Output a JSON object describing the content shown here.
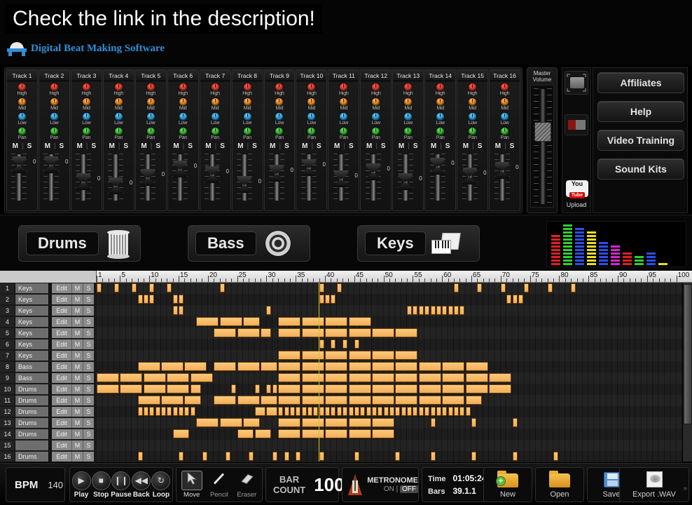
{
  "banner": {
    "headline": "Check the link in the description!",
    "logo_text": "Digital Beat Making Software",
    "logo_color": "#2e8fd6"
  },
  "mixer": {
    "knob_labels": [
      "High",
      "Mid",
      "Low",
      "Pan"
    ],
    "knob_colors": {
      "high": "#d8301c",
      "mid": "#e08a12",
      "low": "#1f9bd8",
      "pan": "#28a828"
    },
    "mute_label": "M",
    "solo_label": "S",
    "fader_value": "0",
    "tracks": [
      {
        "name": "Track 1"
      },
      {
        "name": "Track 2"
      },
      {
        "name": "Track 3"
      },
      {
        "name": "Track 4"
      },
      {
        "name": "Track 5"
      },
      {
        "name": "Track 6"
      },
      {
        "name": "Track 7"
      },
      {
        "name": "Track 8"
      },
      {
        "name": "Track 9"
      },
      {
        "name": "Track 10"
      },
      {
        "name": "Track 11"
      },
      {
        "name": "Track 12"
      },
      {
        "name": "Track 13"
      },
      {
        "name": "Track 14"
      },
      {
        "name": "Track 15"
      },
      {
        "name": "Track 16"
      }
    ],
    "fader_positions": [
      6,
      6,
      30,
      36,
      24,
      12,
      20,
      34,
      18,
      10,
      26,
      16,
      30,
      8,
      22,
      14
    ]
  },
  "master": {
    "label_line1": "Master",
    "label_line2": "Volume"
  },
  "side_panel": {
    "youtube_you": "You",
    "youtube_tube": "Tube",
    "upload_label": "Upload"
  },
  "right_buttons": [
    {
      "label": "Affiliates"
    },
    {
      "label": "Help"
    },
    {
      "label": "Video Training"
    },
    {
      "label": "Sound Kits"
    }
  ],
  "instruments": [
    {
      "label": "Drums",
      "icon": "drum-icon"
    },
    {
      "label": "Bass",
      "icon": "speaker-icon"
    },
    {
      "label": "Keys",
      "icon": "piano-folder-icon"
    }
  ],
  "spectrum": {
    "bars": [
      {
        "color": "#e02020",
        "level": 9
      },
      {
        "color": "#2fd02f",
        "level": 12
      },
      {
        "color": "#2a50e8",
        "level": 11
      },
      {
        "color": "#e8e020",
        "level": 10
      },
      {
        "color": "#2a50e8",
        "level": 7
      },
      {
        "color": "#d028c8",
        "level": 6
      },
      {
        "color": "#e02020",
        "level": 4
      },
      {
        "color": "#2fd02f",
        "level": 3
      },
      {
        "color": "#2a50e8",
        "level": 4
      },
      {
        "color": "#e8e020",
        "level": 1
      }
    ]
  },
  "sequencer": {
    "ruler_start": 1,
    "ruler_end": 100,
    "ruler_labels": [
      1,
      5,
      10,
      15,
      20,
      25,
      30,
      35,
      40,
      45,
      50,
      55,
      60,
      65,
      70,
      75,
      80,
      85,
      90,
      95,
      100
    ],
    "playhead_bar": 39,
    "edit_label": "Edit",
    "mute_label": "M",
    "solo_label": "S",
    "tracks": [
      {
        "num": "1",
        "name": "Keys"
      },
      {
        "num": "2",
        "name": "Keys"
      },
      {
        "num": "3",
        "name": "Keys"
      },
      {
        "num": "4",
        "name": "Keys"
      },
      {
        "num": "5",
        "name": "Keys"
      },
      {
        "num": "6",
        "name": "Keys"
      },
      {
        "num": "7",
        "name": "Keys"
      },
      {
        "num": "8",
        "name": "Bass"
      },
      {
        "num": "9",
        "name": "Bass"
      },
      {
        "num": "10",
        "name": "Drums"
      },
      {
        "num": "11",
        "name": "Drums"
      },
      {
        "num": "12",
        "name": "Drums"
      },
      {
        "num": "13",
        "name": "Drums"
      },
      {
        "num": "14",
        "name": "Drums"
      },
      {
        "num": "15",
        "name": ""
      },
      {
        "num": "16",
        "name": "Drums"
      }
    ],
    "notes": [
      [
        [
          1,
          1
        ],
        [
          4,
          1
        ],
        [
          7,
          1
        ],
        [
          10,
          1
        ],
        [
          13,
          1
        ],
        [
          22,
          1
        ],
        [
          39,
          1
        ],
        [
          42,
          1
        ],
        [
          62,
          1
        ],
        [
          66,
          1
        ],
        [
          70,
          1
        ],
        [
          74,
          1
        ],
        [
          78,
          1
        ],
        [
          82,
          1
        ]
      ],
      [
        [
          8,
          1
        ],
        [
          9,
          1
        ],
        [
          10,
          1
        ],
        [
          14,
          1
        ],
        [
          15,
          1
        ],
        [
          39,
          1
        ],
        [
          40,
          1
        ],
        [
          41,
          1
        ],
        [
          71,
          1
        ],
        [
          72,
          1
        ],
        [
          73,
          1
        ]
      ],
      [
        [
          14,
          1
        ],
        [
          15,
          1
        ],
        [
          30,
          1
        ],
        [
          54,
          1
        ],
        [
          55,
          1
        ],
        [
          56,
          1
        ],
        [
          57,
          1
        ],
        [
          58,
          1
        ],
        [
          59,
          1
        ],
        [
          60,
          1
        ],
        [
          61,
          1
        ],
        [
          62,
          1
        ],
        [
          63,
          1
        ]
      ],
      [
        [
          18,
          4
        ],
        [
          22,
          4
        ],
        [
          26,
          3
        ],
        [
          32,
          4
        ],
        [
          36,
          4
        ],
        [
          40,
          4
        ],
        [
          44,
          4
        ]
      ],
      [
        [
          21,
          4
        ],
        [
          25,
          4
        ],
        [
          29,
          2
        ],
        [
          32,
          4
        ],
        [
          36,
          4
        ],
        [
          40,
          4
        ],
        [
          44,
          4
        ],
        [
          48,
          4
        ],
        [
          52,
          4
        ]
      ],
      [
        [
          39,
          1
        ],
        [
          41,
          1
        ],
        [
          43,
          1
        ],
        [
          45,
          1
        ]
      ],
      [
        [
          32,
          4
        ],
        [
          36,
          4
        ],
        [
          40,
          4
        ],
        [
          44,
          4
        ],
        [
          48,
          4
        ],
        [
          52,
          4
        ]
      ],
      [
        [
          8,
          4
        ],
        [
          12,
          4
        ],
        [
          16,
          4
        ],
        [
          21,
          4
        ],
        [
          25,
          4
        ],
        [
          29,
          3
        ],
        [
          32,
          4
        ],
        [
          36,
          4
        ],
        [
          40,
          4
        ],
        [
          44,
          4
        ],
        [
          48,
          4
        ],
        [
          52,
          4
        ],
        [
          56,
          4
        ],
        [
          60,
          4
        ],
        [
          64,
          4
        ]
      ],
      [
        [
          1,
          4
        ],
        [
          5,
          4
        ],
        [
          9,
          4
        ],
        [
          13,
          4
        ],
        [
          17,
          4
        ],
        [
          32,
          4
        ],
        [
          36,
          4
        ],
        [
          40,
          4
        ],
        [
          44,
          4
        ],
        [
          48,
          4
        ],
        [
          52,
          4
        ],
        [
          56,
          4
        ],
        [
          60,
          4
        ],
        [
          64,
          4
        ],
        [
          68,
          4
        ]
      ],
      [
        [
          1,
          4
        ],
        [
          5,
          4
        ],
        [
          9,
          4
        ],
        [
          13,
          4
        ],
        [
          17,
          2
        ],
        [
          24,
          1
        ],
        [
          28,
          1
        ],
        [
          30,
          1
        ],
        [
          31,
          1
        ],
        [
          32,
          4
        ],
        [
          36,
          4
        ],
        [
          40,
          4
        ],
        [
          44,
          4
        ],
        [
          48,
          4
        ],
        [
          52,
          4
        ],
        [
          56,
          4
        ],
        [
          60,
          4
        ],
        [
          64,
          4
        ],
        [
          68,
          4
        ]
      ],
      [
        [
          8,
          4
        ],
        [
          12,
          4
        ],
        [
          16,
          3
        ],
        [
          21,
          4
        ],
        [
          25,
          4
        ],
        [
          29,
          3
        ],
        [
          32,
          4
        ],
        [
          36,
          4
        ],
        [
          40,
          4
        ],
        [
          44,
          4
        ],
        [
          48,
          4
        ],
        [
          52,
          4
        ],
        [
          56,
          4
        ],
        [
          60,
          4
        ],
        [
          64,
          3
        ]
      ],
      [
        [
          8,
          1
        ],
        [
          9,
          1
        ],
        [
          10,
          1
        ],
        [
          11,
          1
        ],
        [
          12,
          1
        ],
        [
          13,
          1
        ],
        [
          14,
          1
        ],
        [
          15,
          1
        ],
        [
          16,
          1
        ],
        [
          17,
          1
        ],
        [
          28,
          2
        ],
        [
          30,
          2
        ],
        [
          32,
          1
        ],
        [
          33,
          1
        ],
        [
          34,
          1
        ],
        [
          35,
          1
        ],
        [
          36,
          1
        ],
        [
          37,
          1
        ],
        [
          38,
          1
        ],
        [
          39,
          1
        ],
        [
          40,
          1
        ],
        [
          41,
          1
        ],
        [
          42,
          1
        ],
        [
          43,
          1
        ],
        [
          44,
          1
        ],
        [
          45,
          1
        ],
        [
          46,
          1
        ],
        [
          47,
          1
        ],
        [
          48,
          1
        ],
        [
          49,
          1
        ],
        [
          50,
          1
        ],
        [
          51,
          1
        ],
        [
          52,
          1
        ],
        [
          53,
          1
        ],
        [
          54,
          1
        ],
        [
          55,
          1
        ],
        [
          56,
          1
        ],
        [
          57,
          1
        ],
        [
          58,
          1
        ],
        [
          59,
          1
        ],
        [
          60,
          1
        ],
        [
          61,
          1
        ],
        [
          62,
          1
        ],
        [
          63,
          1
        ],
        [
          64,
          1
        ]
      ],
      [
        [
          18,
          4
        ],
        [
          22,
          4
        ],
        [
          26,
          3
        ],
        [
          32,
          4
        ],
        [
          36,
          4
        ],
        [
          40,
          4
        ],
        [
          44,
          4
        ],
        [
          48,
          4
        ],
        [
          58,
          1
        ],
        [
          65,
          1
        ],
        [
          72,
          1
        ]
      ],
      [
        [
          14,
          3
        ],
        [
          25,
          3
        ],
        [
          28,
          3
        ],
        [
          32,
          4
        ],
        [
          36,
          4
        ],
        [
          40,
          4
        ],
        [
          44,
          4
        ],
        [
          48,
          4
        ]
      ],
      [],
      [
        [
          8,
          1
        ],
        [
          15,
          1
        ],
        [
          19,
          1
        ],
        [
          23,
          1
        ],
        [
          27,
          1
        ],
        [
          31,
          1
        ],
        [
          33,
          1
        ],
        [
          35,
          1
        ],
        [
          39,
          1
        ],
        [
          45,
          1
        ],
        [
          52,
          1
        ],
        [
          58,
          1
        ],
        [
          65,
          1
        ],
        [
          72,
          1
        ],
        [
          79,
          1
        ]
      ]
    ]
  },
  "toolbar": {
    "bpm_label": "BPM",
    "bpm_value": "140",
    "transport": [
      {
        "label": "Play",
        "glyph": "▶"
      },
      {
        "label": "Stop",
        "glyph": "■"
      },
      {
        "label": "Pause",
        "glyph": "❙❙"
      },
      {
        "label": "Back",
        "glyph": "◀◀"
      },
      {
        "label": "Loop",
        "glyph": "↻"
      }
    ],
    "tools": [
      {
        "label": "Move",
        "selected": true
      },
      {
        "label": "Pencil",
        "selected": false
      },
      {
        "label": "Eraser",
        "selected": false
      }
    ],
    "bar_count_line1": "BAR",
    "bar_count_line2": "COUNT",
    "bar_count_value": "100",
    "metronome_label": "METRONOME",
    "metronome_on": "ON",
    "metronome_off": "OFF",
    "time_label": "Time",
    "time_value": "01:05:24",
    "bars_label": "Bars",
    "bars_value": "39.1.1",
    "file_buttons": [
      {
        "label": "New",
        "icon": "new-folder-icon"
      },
      {
        "label": "Open",
        "icon": "open-folder-icon"
      },
      {
        "label": "Save",
        "icon": "floppy-disk-icon"
      },
      {
        "label": "Export .WAV",
        "icon": "export-wav-icon"
      }
    ]
  }
}
